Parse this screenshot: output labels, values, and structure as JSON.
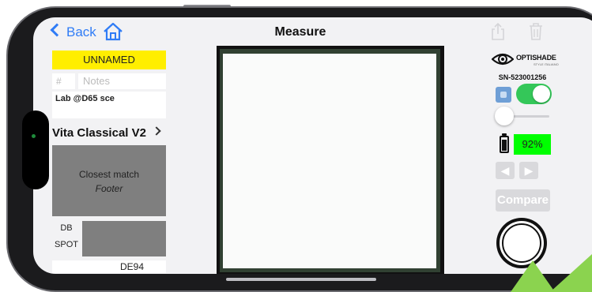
{
  "nav": {
    "back_label": "Back",
    "title": "Measure"
  },
  "shade": {
    "name": "UNNAMED",
    "number_placeholder": "#",
    "notes_placeholder": "Notes",
    "measurement_info": "Lab @D65 sce",
    "shade_guide": "Vita Classical V2",
    "closest_match_title": "Closest match",
    "closest_match_value": "Footer",
    "db_label": "DB",
    "spot_label": "SPOT",
    "delta_e_label": "DE94"
  },
  "device": {
    "brand": "OPTISHADE",
    "brand_tagline": "STYLE ITALIANO",
    "serial": "SN-523001256",
    "light_toggle_on": true,
    "battery_percent": "92%",
    "compare_label": "Compare"
  },
  "colors": {
    "accent_blue": "#2f7cf6",
    "name_highlight": "#ffee00",
    "battery_ok": "#00ff00",
    "toggle_on": "#34c759",
    "swatch_gray": "#7f7f7f"
  },
  "icons": {
    "back": "chevron-left-icon",
    "home": "home-icon",
    "share": "share-icon",
    "trash": "trash-icon",
    "eye": "eye-icon",
    "battery": "battery-icon",
    "prev": "arrow-left-icon",
    "next": "arrow-right-icon"
  }
}
